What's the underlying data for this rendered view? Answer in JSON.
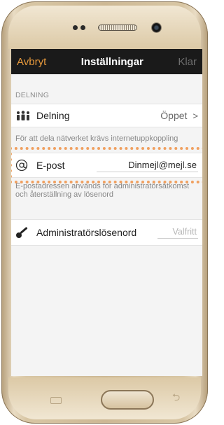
{
  "navbar": {
    "cancel_label": "Avbryt",
    "title": "Inställningar",
    "done_label": "Klar"
  },
  "sharing": {
    "section_header": "DELNING",
    "label": "Delning",
    "value": "Öppet",
    "chevron": ">",
    "note": "För att dela nätverket krävs internetuppkoppling"
  },
  "email": {
    "label": "E-post",
    "value": "Dinmejl@mejl.se",
    "note": "E-postadressen används för administratörsåtkomst och återställning av lösenord",
    "highlight_color": "#f0a060"
  },
  "admin": {
    "label": "Administratörslösenord",
    "placeholder": "Valfritt"
  },
  "colors": {
    "accent": "#e89a3c",
    "navbar_bg": "#1a1a1a"
  },
  "icons": {
    "sharing": "people-group-icon",
    "email": "at-sign-icon",
    "admin": "key-icon"
  }
}
